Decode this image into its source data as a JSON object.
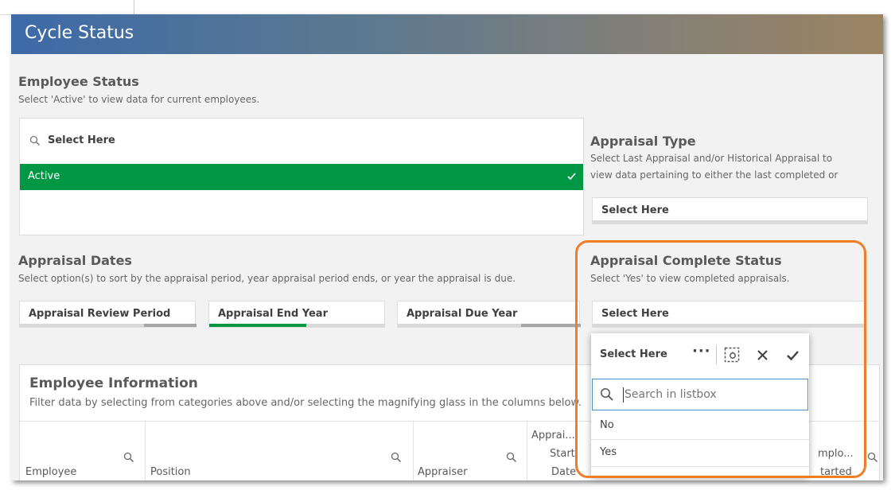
{
  "app": {
    "title": "Cycle Status"
  },
  "employee_status": {
    "title": "Employee Status",
    "description": "Select 'Active' to view data for current employees.",
    "search_label": "Select Here",
    "items": [
      {
        "label": "Active",
        "selected": true
      }
    ],
    "selected_color": "#009845"
  },
  "appraisal_type": {
    "title": "Appraisal Type",
    "description_line1": "Select Last Appraisal and/or Historical Appraisal to",
    "description_line2": "view data pertaining to either the last completed or",
    "select_label": "Select Here"
  },
  "appraisal_dates": {
    "title": "Appraisal Dates",
    "description": "Select option(s) to sort by the appraisal period, year appraisal period ends, or year the appraisal is due.",
    "filters": [
      {
        "label": "Appraisal Review Period",
        "selected_fraction": 0.62
      },
      {
        "label": "Appraisal End Year",
        "selected_fraction": 0.55
      },
      {
        "label": "Appraisal Due Year",
        "selected_fraction": 0.75
      }
    ]
  },
  "appraisal_complete_status": {
    "title": "Appraisal Complete Status",
    "description": "Select 'Yes' to view completed appraisals.",
    "select_label": "Select Here"
  },
  "dropdown": {
    "header_label": "Select Here",
    "more_icon": "ellipsis-icon",
    "search_placeholder": "Search in listbox",
    "options": [
      "No",
      "Yes"
    ]
  },
  "employee_information": {
    "title": "Employee Information",
    "description": "Filter data by selecting from categories above and/or selecting the magnifying glass in the columns below.",
    "columns": [
      {
        "label": "Employee"
      },
      {
        "label": "Position"
      },
      {
        "label": "Appraiser"
      },
      {
        "label_lines": [
          "Apprai...",
          "Start",
          "Date"
        ]
      },
      {
        "label_lines": [
          "mplo...",
          "tarted"
        ]
      }
    ]
  },
  "colors": {
    "highlight_border": "#f07d28",
    "accent_green": "#009845",
    "dark_bar": "#a6a6a6"
  }
}
